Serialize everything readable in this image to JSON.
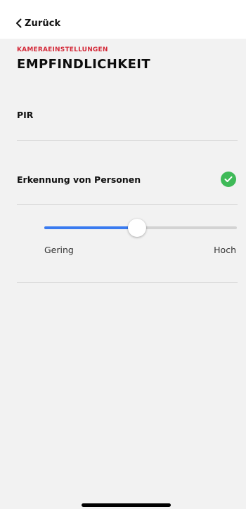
{
  "nav": {
    "back_label": "Zurück"
  },
  "header": {
    "section": "KAMERAEINSTELLUNGEN",
    "title": "EMPFINDLICHKEIT"
  },
  "options": [
    {
      "label": "PIR",
      "selected": false
    },
    {
      "label": "Erkennung von Personen",
      "selected": true
    }
  ],
  "sensitivity": {
    "min_label": "Gering",
    "max_label": "Hoch",
    "value": 0.48
  },
  "colors": {
    "accent": "#d42b3a",
    "slider_fill": "#3a7bf0",
    "check": "#3fba58",
    "background": "#f2f2f2"
  },
  "icons": {
    "back": "chevron-left-icon",
    "selected": "check-circle-icon"
  }
}
